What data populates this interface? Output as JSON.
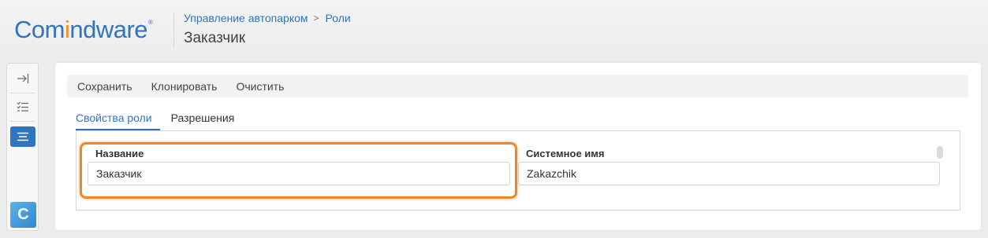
{
  "header": {
    "logo_part1": "Com",
    "logo_part2": "i",
    "logo_part3": "ndware",
    "logo_registered": "®",
    "breadcrumb": [
      "Управление автопарком",
      "Роли"
    ],
    "breadcrumb_separator": ">",
    "page_title": "Заказчик"
  },
  "sidenav": {
    "items": [
      {
        "icon": "collapse-sidebar-icon",
        "glyph": "→|"
      },
      {
        "icon": "task-list-icon",
        "glyph": "☰"
      },
      {
        "icon": "menu-icon",
        "glyph": "≡",
        "active": true
      }
    ],
    "app_badge": "C"
  },
  "toolbar": {
    "save_label": "Сохранить",
    "clone_label": "Клонировать",
    "clear_label": "Очистить"
  },
  "tabs": [
    {
      "label": "Свойства роли",
      "active": true
    },
    {
      "label": "Разрешения",
      "active": false
    }
  ],
  "form": {
    "name": {
      "label": "Название",
      "value": "Заказчик"
    },
    "system_name": {
      "label": "Системное имя",
      "value": "Zakazchik"
    }
  },
  "colors": {
    "accent": "#2f74bd",
    "highlight": "#f0862a",
    "logo_orange": "#f0911f"
  }
}
